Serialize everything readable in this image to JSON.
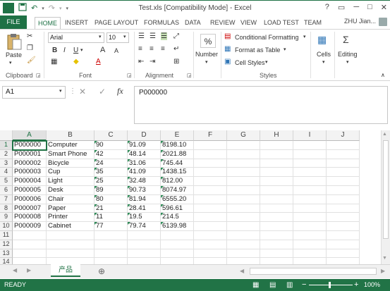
{
  "window": {
    "title": "Test.xls  [Compatibility Mode] - Excel",
    "help": "?",
    "restore": "▭",
    "minimize": "─",
    "maximize": "□",
    "close": "✕"
  },
  "qat": {
    "app_icon": "X",
    "save_icon": "save-icon",
    "undo_icon": "undo-icon",
    "redo_icon": "redo-icon",
    "customize_icon": "customize-icon"
  },
  "tabs": [
    "FILE",
    "HOME",
    "INSERT",
    "PAGE LAYOUT",
    "FORMULAS",
    "DATA",
    "REVIEW",
    "VIEW",
    "LOAD TEST",
    "TEAM"
  ],
  "active_tab": "HOME",
  "user": "ZHU Jian...",
  "ribbon": {
    "clipboard": {
      "paste": "Paste",
      "label": "Clipboard"
    },
    "font": {
      "name": "Arial",
      "size": "10",
      "label": "Font",
      "bold": "B",
      "italic": "I",
      "underline": "U",
      "grow": "A",
      "shrink": "A",
      "fontcolor": "A"
    },
    "alignment": {
      "label": "Alignment"
    },
    "number": {
      "label": "Number",
      "symbol": "%",
      "text": "Number"
    },
    "styles": {
      "label": "Styles",
      "conditional": "Conditional Formatting",
      "table": "Format as Table",
      "cell": "Cell Styles"
    },
    "cells": {
      "label": "Cells"
    },
    "editing": {
      "label": "Editing"
    }
  },
  "formula_bar": {
    "name_box": "A1",
    "cancel": "✕",
    "enter": "✓",
    "fx": "fx",
    "value": "P000000"
  },
  "columns": [
    "A",
    "B",
    "C",
    "D",
    "E",
    "F",
    "G",
    "H",
    "I",
    "J"
  ],
  "rows": [
    "1",
    "2",
    "3",
    "4",
    "5",
    "6",
    "7",
    "8",
    "9",
    "10",
    "11",
    "12",
    "13",
    "14"
  ],
  "cells": [
    [
      "P000000",
      "Computer",
      "90",
      "91.09",
      "8198.10"
    ],
    [
      "P000001",
      "Smart Phone",
      "42",
      "48.14",
      "2021.88"
    ],
    [
      "P000002",
      "Bicycle",
      "24",
      "31.06",
      "745.44"
    ],
    [
      "P000003",
      "Cup",
      "35",
      "41.09",
      "1438.15"
    ],
    [
      "P000004",
      "Light",
      "25",
      "32.48",
      "812.00"
    ],
    [
      "P000005",
      "Desk",
      "89",
      "90.73",
      "8074.97"
    ],
    [
      "P000006",
      "Chair",
      "80",
      "81.94",
      "6555.20"
    ],
    [
      "P000007",
      "Paper",
      "21",
      "28.41",
      "596.61"
    ],
    [
      "P000008",
      "Printer",
      "11",
      "19.5",
      "214.5"
    ],
    [
      "P000009",
      "Cabinet",
      "77",
      "79.74",
      "6139.98"
    ]
  ],
  "sheet": {
    "name": "产品",
    "add": "⊕",
    "prev": "◀",
    "next": "▶"
  },
  "status": {
    "text": "READY",
    "zoom": "100%",
    "zoom_minus": "−",
    "zoom_plus": "+"
  },
  "colors": {
    "accent": "#217346",
    "file_tab": "#1e7145"
  }
}
